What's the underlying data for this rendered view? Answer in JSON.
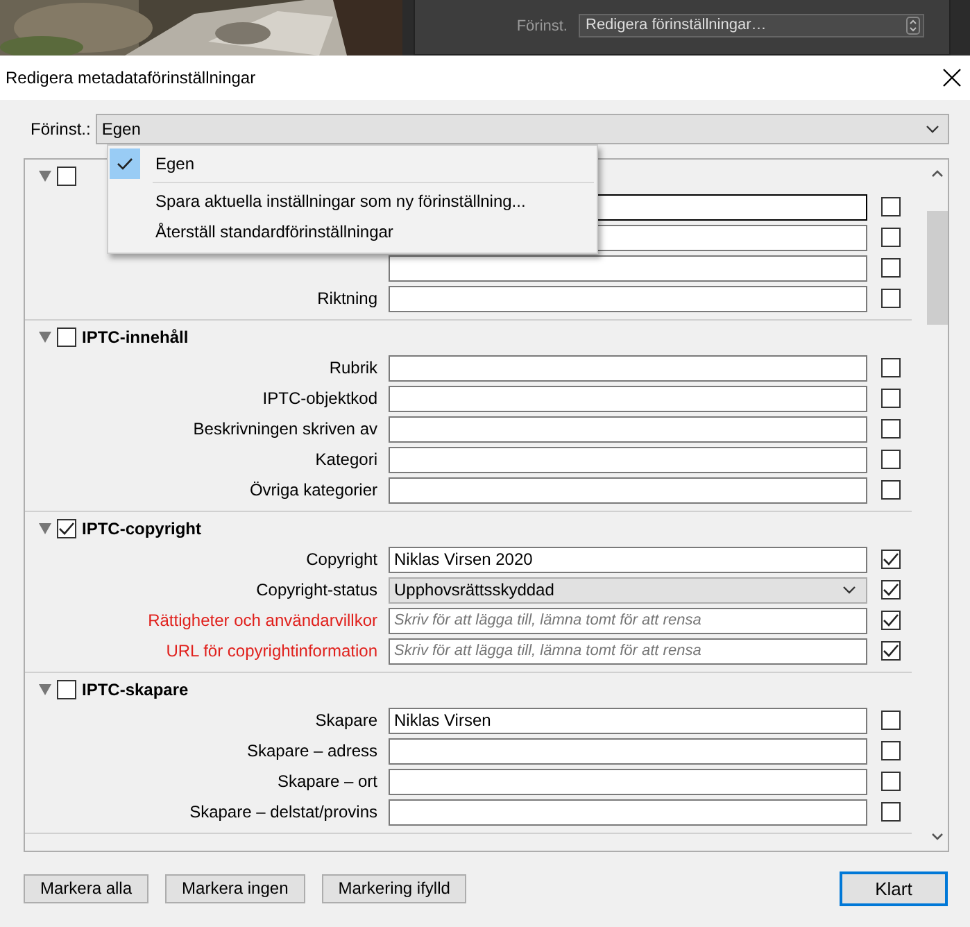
{
  "background": {
    "preset_label": "Förinst.",
    "preset_value": "Redigera förinställningar…"
  },
  "dialog": {
    "title": "Redigera metadataförinställningar",
    "preset": {
      "label": "Förinst.:",
      "value": "Egen"
    },
    "preset_menu": [
      {
        "kind": "option",
        "label": "Egen",
        "selected": true
      },
      {
        "kind": "action",
        "label": "Spara aktuella inställningar som ny förinställning..."
      },
      {
        "kind": "action",
        "label": "Återställ standardförinställningar"
      }
    ],
    "sections": [
      {
        "checked": false,
        "expanded": true,
        "rows": [
          {
            "kind": "text",
            "checked": false,
            "focused": true
          },
          {
            "kind": "text",
            "checked": false
          },
          {
            "kind": "text",
            "checked": false
          },
          {
            "kind": "text",
            "label": "Riktning",
            "checked": false
          }
        ]
      },
      {
        "title": "IPTC-innehåll",
        "checked": false,
        "expanded": true,
        "rows": [
          {
            "kind": "text",
            "label": "Rubrik",
            "checked": false
          },
          {
            "kind": "text",
            "label": "IPTC-objektkod",
            "checked": false
          },
          {
            "kind": "text",
            "label": "Beskrivningen skriven av",
            "checked": false
          },
          {
            "kind": "text",
            "label": "Kategori",
            "checked": false
          },
          {
            "kind": "text",
            "label": "Övriga kategorier",
            "checked": false
          }
        ]
      },
      {
        "title": "IPTC-copyright",
        "checked": true,
        "expanded": true,
        "rows": [
          {
            "kind": "text",
            "label": "Copyright",
            "value": "Niklas Virsen 2020",
            "checked": true
          },
          {
            "kind": "select",
            "label": "Copyright-status",
            "value": "Upphovsrättsskyddad",
            "checked": true
          },
          {
            "kind": "text",
            "label": "Rättigheter och användarvillkor",
            "placeholder": "Skriv för att lägga till, lämna tomt för att rensa",
            "changed": true,
            "checked": true
          },
          {
            "kind": "text",
            "label": "URL för copyrightinformation",
            "placeholder": "Skriv för att lägga till, lämna tomt för att rensa",
            "changed": true,
            "checked": true
          }
        ]
      },
      {
        "title": "IPTC-skapare",
        "checked": false,
        "expanded": true,
        "rows": [
          {
            "kind": "text",
            "label": "Skapare",
            "value": "Niklas Virsen",
            "checked": false
          },
          {
            "kind": "text",
            "label": "Skapare – adress",
            "checked": false
          },
          {
            "kind": "text",
            "label": "Skapare – ort",
            "checked": false
          },
          {
            "kind": "text",
            "label": "Skapare – delstat/provins",
            "checked": false
          }
        ]
      }
    ],
    "buttons": [
      {
        "label": "Markera alla",
        "default": false
      },
      {
        "label": "Markera ingen",
        "default": false
      },
      {
        "label": "Markering ifylld",
        "default": false
      },
      {
        "label": "Klart",
        "default": true
      }
    ]
  }
}
